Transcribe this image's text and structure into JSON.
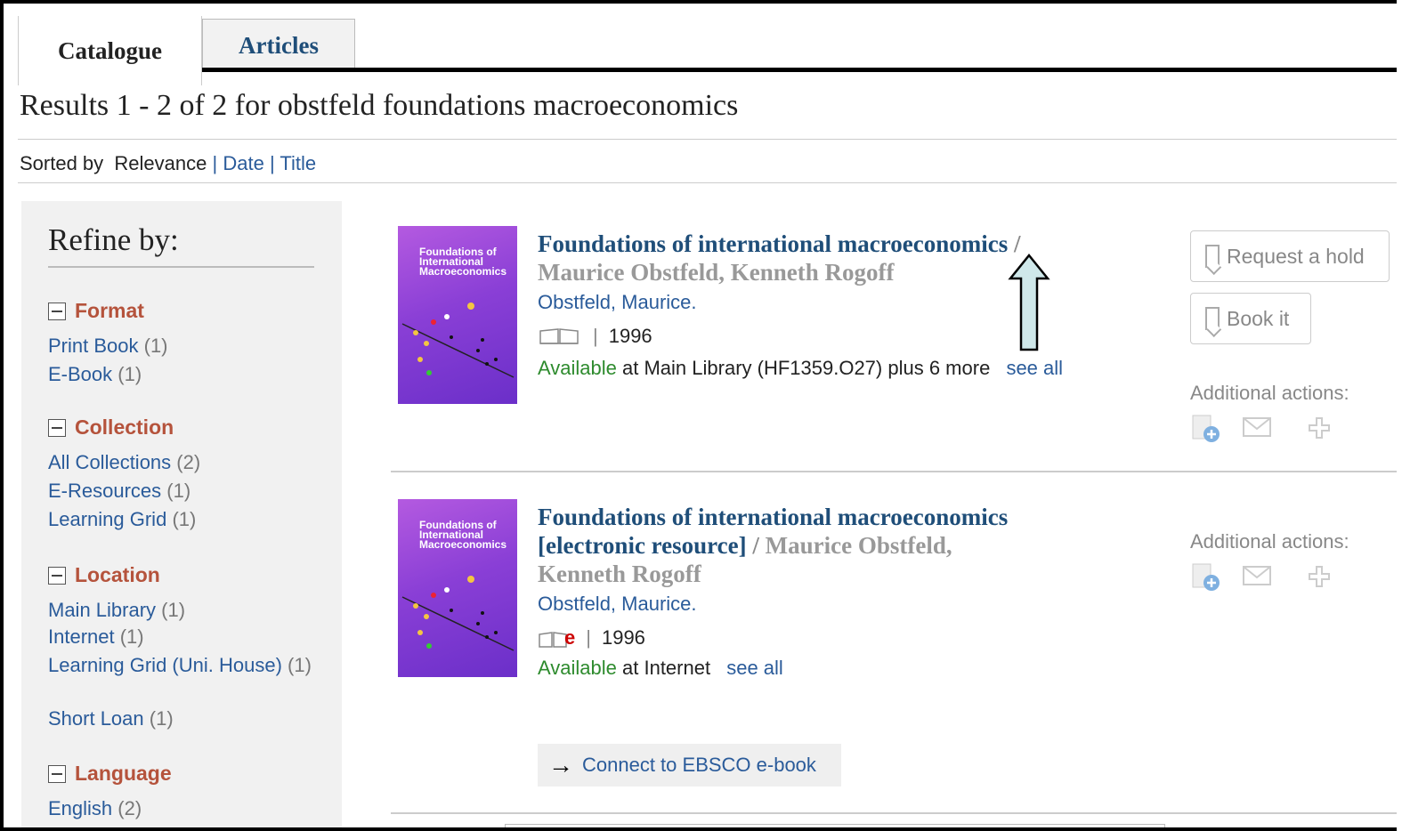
{
  "tabs": [
    {
      "label": "Catalogue"
    },
    {
      "label": "Articles"
    }
  ],
  "results_heading": "Results 1 - 2 of 2 for obstfeld foundations macroeconomics",
  "sort": {
    "prefix": "Sorted by",
    "current": "Relevance",
    "separator": "|",
    "options": [
      "Date",
      "Title"
    ]
  },
  "sidebar": {
    "title": "Refine by:",
    "facets": [
      {
        "label": "Format",
        "items": [
          {
            "name": "Print Book",
            "count": "(1)"
          },
          {
            "name": "E-Book",
            "count": "(1)"
          }
        ]
      },
      {
        "label": "Collection",
        "items": [
          {
            "name": "All Collections",
            "count": "(2)"
          },
          {
            "name": "E-Resources",
            "count": "(1)"
          },
          {
            "name": "Learning Grid",
            "count": "(1)"
          }
        ]
      },
      {
        "label": "Location",
        "items": [
          {
            "name": "Main Library",
            "count": "(1)"
          },
          {
            "name": "Internet",
            "count": "(1)"
          },
          {
            "name": "Learning Grid (Uni. House)",
            "count": "(1)"
          },
          {
            "name": "Short Loan",
            "count": "(1)"
          }
        ]
      },
      {
        "label": "Language",
        "items": [
          {
            "name": "English",
            "count": "(2)"
          }
        ]
      }
    ]
  },
  "cover_text": "Foundations of International Macroeconomics",
  "records": [
    {
      "title": "Foundations of international macroeconomics",
      "slash": "/",
      "responsibility": "Maurice Obstfeld, Kenneth Rogoff",
      "author": "Obstfeld, Maurice.",
      "year": "1996",
      "pipe": "|",
      "availability_status": "Available",
      "availability_detail": "at Main Library (HF1359.O27) plus 6 more",
      "see_all": "see all",
      "format_icon": "book-icon"
    },
    {
      "title": "Foundations of international macroeconomics",
      "title_suffix": "[electronic resource]",
      "slash": "/",
      "responsibility_line1": "Maurice Obstfeld,",
      "responsibility_line2": "Kenneth Rogoff",
      "author": "Obstfeld, Maurice.",
      "year": "1996",
      "pipe": "|",
      "availability_status": "Available",
      "availability_detail": "at Internet",
      "see_all": "see all",
      "format_icon": "ebook-icon",
      "ebook_marker": "e",
      "connect_label": "Connect to EBSCO e-book"
    }
  ],
  "actions": {
    "request_hold": "Request a hold",
    "book_it": "Book it",
    "additional": "Additional actions:"
  },
  "colors": {
    "title_link": "#1f4e79",
    "facet_heading": "#b5533c",
    "link": "#2a5b9a",
    "available": "#2e8b2e",
    "annotation_arrow": "#cfe8ea"
  }
}
